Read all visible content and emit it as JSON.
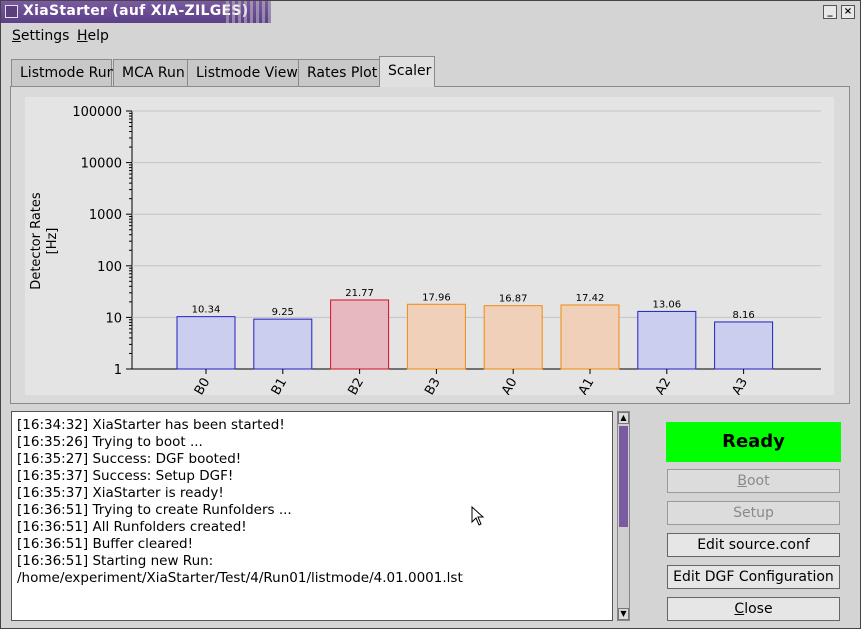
{
  "window": {
    "title": "XiaStarter (auf XIA-ZILGES)",
    "accent": "#6a4c93"
  },
  "menu": [
    {
      "label_ul": "S",
      "label_rest": "ettings"
    },
    {
      "label_ul": "H",
      "label_rest": "elp"
    }
  ],
  "tabs": [
    "Listmode Run",
    "MCA Run",
    "Listmode View",
    "Rates Plot",
    "Scaler"
  ],
  "active_tab": "Scaler",
  "chart_data": {
    "type": "bar",
    "ylabel_line1": "Detector Rates",
    "ylabel_line2": "[Hz]",
    "yscale": "log",
    "ylim": [
      1,
      100000
    ],
    "ytick_labels": [
      "1",
      "10",
      "100",
      "1000",
      "10000",
      "100000"
    ],
    "ytick_values": [
      1,
      10,
      100,
      1000,
      10000,
      100000
    ],
    "categories": [
      "B0",
      "B1",
      "B2",
      "B3",
      "A0",
      "A1",
      "A2",
      "A3"
    ],
    "values": [
      10.34,
      9.25,
      21.77,
      17.96,
      16.87,
      17.42,
      13.06,
      8.16
    ],
    "value_labels": [
      "10.34",
      "9.25",
      "21.77",
      "17.96",
      "16.87",
      "17.42",
      "13.06",
      "8.16"
    ],
    "fill_colors": [
      "#cccef0",
      "#cccef0",
      "#e8b8c0",
      "#f0d0b8",
      "#f0d0b8",
      "#f0d0b8",
      "#cccef0",
      "#cccef0"
    ],
    "edge_colors": [
      "#2020c0",
      "#2020c0",
      "#d01020",
      "#f08a10",
      "#f08a10",
      "#f08a10",
      "#2020c0",
      "#2020c0"
    ]
  },
  "log": [
    "[16:34:32] XiaStarter has been started!",
    "[16:35:26] Trying to boot ...",
    "[16:35:27] Success: DGF booted!",
    "[16:35:37] Success: Setup DGF!",
    "[16:35:37] XiaStarter is ready!",
    "[16:36:51] Trying to create Runfolders ...",
    "[16:36:51] All Runfolders created!",
    "[16:36:51] Buffer cleared!",
    "[16:36:51] Starting new Run:",
    "/home/experiment/XiaStarter/Test/4/Run01/listmode/4.01.0001.lst"
  ],
  "status": {
    "text": "Ready",
    "color": "#00ff00"
  },
  "buttons": {
    "boot": {
      "ul": "B",
      "rest": "oot"
    },
    "setup": "Setup",
    "edit_source": "Edit source.conf",
    "edit_dgf": "Edit DGF Configuration",
    "close": {
      "ul": "C",
      "rest": "lose"
    }
  }
}
